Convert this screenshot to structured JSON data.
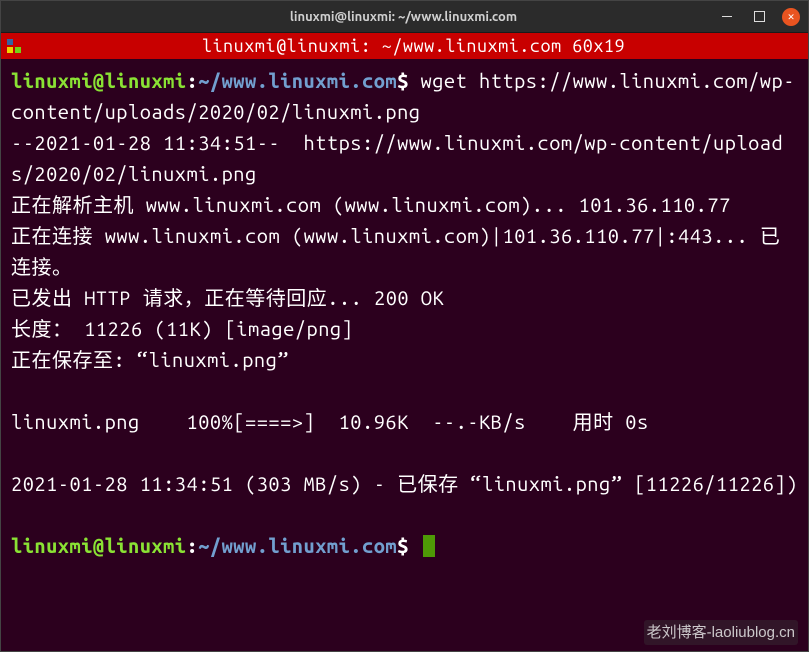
{
  "titlebar": {
    "title": "linuxmi@linuxmi: ~/www.linuxmi.com"
  },
  "red_header": {
    "title": "linuxmi@linuxmi: ~/www.linuxmi.com 60x19"
  },
  "prompt": {
    "user": "linuxmi@linuxmi",
    "path": "~/www.linuxmi.com",
    "dollar": "$"
  },
  "terminal": {
    "cmd1": " wget https://www.linuxmi.com/wp-content/uploads/2020/02/linuxmi.png",
    "out1": "--2021-01-28 11:34:51--  https://www.linuxmi.com/wp-content/uploads/2020/02/linuxmi.png",
    "out2": "正在解析主机 www.linuxmi.com (www.linuxmi.com)... 101.36.110.77",
    "out3": "正在连接 www.linuxmi.com (www.linuxmi.com)|101.36.110.77|:443... 已连接。",
    "out4": "已发出 HTTP 请求，正在等待回应... 200 OK",
    "out5": "长度： 11226 (11K) [image/png]",
    "out6": "正在保存至: “linuxmi.png”",
    "blank": " ",
    "progress": "linuxmi.png    100%[====>]  10.96K  --.-KB/s    用时 0s",
    "blank2": " ",
    "final": "2021-01-28 11:34:51 (303 MB/s) - 已保存 “linuxmi.png” [11226/11226])",
    "blank3": " "
  },
  "watermark": "老刘博客-laoliublog.cn"
}
